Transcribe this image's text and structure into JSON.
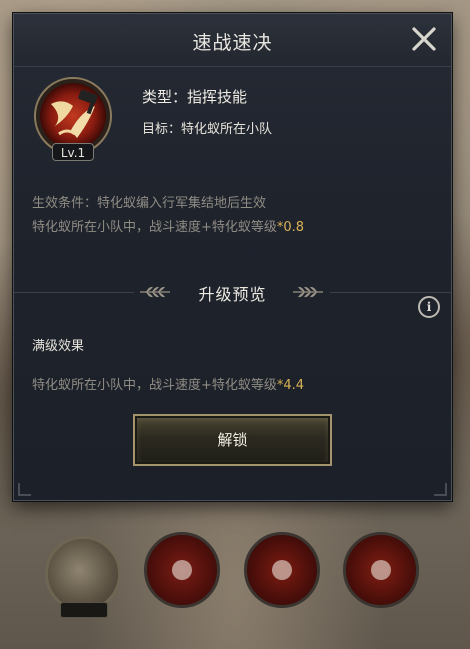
{
  "dialog": {
    "title": "速战速决",
    "close_icon": "close-x-icon"
  },
  "skill": {
    "icon": "command-skill-emblem-icon",
    "level_label": "Lv.1",
    "type_text": "类型：指挥技能",
    "target_text": "目标：特化蚁所在小队",
    "condition_text": "生效条件：特化蚁编入行军集结地后生效",
    "effect_prefix": "特化蚁所在小队中，战斗速度+特化蚁等级",
    "effect_value": "*0.8"
  },
  "upgrade_preview": {
    "section_title": "升级预览",
    "info_icon_glyph": "i",
    "max_label": "满级效果",
    "max_effect_prefix": "特化蚁所在小队中，战斗速度+特化蚁等级",
    "max_effect_value": "*4.4"
  },
  "actions": {
    "unlock_label": "解锁"
  },
  "colors": {
    "accent_gold": "#d9b256",
    "panel_bg": "#1f232c",
    "muted_text": "#8f8c84"
  },
  "skill_slots": [
    {
      "icon": "ant-portrait-icon"
    },
    {
      "icon": "red-skill-icon"
    },
    {
      "icon": "red-skill-icon"
    },
    {
      "icon": "red-skill-icon"
    }
  ]
}
